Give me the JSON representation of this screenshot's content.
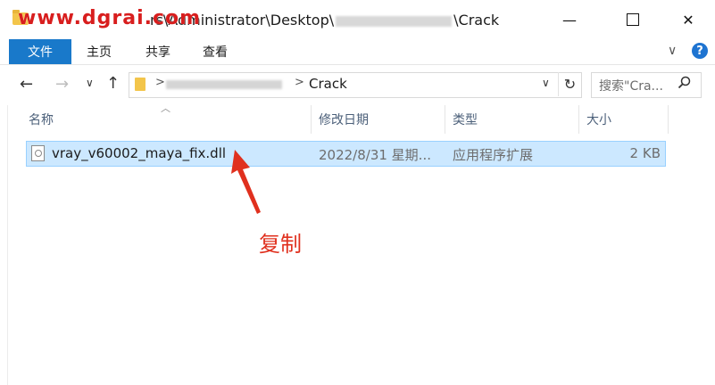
{
  "title": {
    "watermark": "www.dgrai.com",
    "path_prefix": "rs\\Administrator\\Desktop\\",
    "path_suffix": "\\Crack",
    "minimize": "—",
    "close": "✕"
  },
  "ribbon": {
    "tabs": [
      "文件",
      "主页",
      "共享",
      "查看"
    ],
    "expand": "∨",
    "help": "?"
  },
  "nav": {
    "back": "←",
    "forward": "→",
    "recent": "∨",
    "up": "↑",
    "sep": ">",
    "current_folder": "Crack",
    "dropdown": "∨",
    "refresh": "↻",
    "search_placeholder": "搜索\"Cra...",
    "search_icon": "search-icon"
  },
  "columns": {
    "name": "名称",
    "date": "修改日期",
    "type": "类型",
    "size": "大小"
  },
  "files": [
    {
      "name": "vray_v60002_maya_fix.dll",
      "date": "2022/8/31 星期...",
      "type": "应用程序扩展",
      "size": "2 KB"
    }
  ],
  "annotation": {
    "text": "复制",
    "color": "#e0301e"
  },
  "colors": {
    "file_tab": "#1979ca",
    "selection": "#cce8ff",
    "help": "#1e74d1"
  }
}
